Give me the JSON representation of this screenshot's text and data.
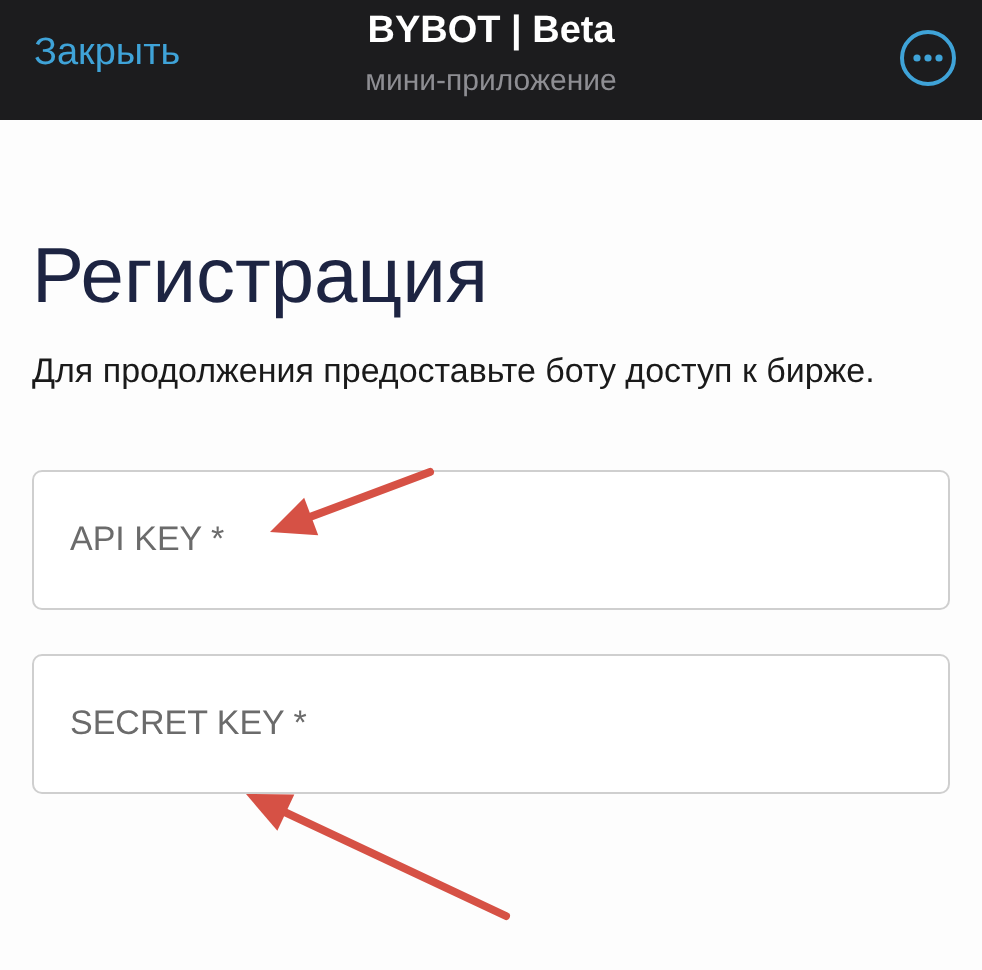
{
  "header": {
    "close": "Закрыть",
    "title": "BYBOT | Beta",
    "subtitle": "мини-приложение"
  },
  "heading": "Регистрация",
  "description": "Для продолжения предоставьте боту доступ к бирже.",
  "fields": [
    {
      "placeholder": "API KEY *"
    },
    {
      "placeholder": "SECRET KEY *"
    }
  ]
}
